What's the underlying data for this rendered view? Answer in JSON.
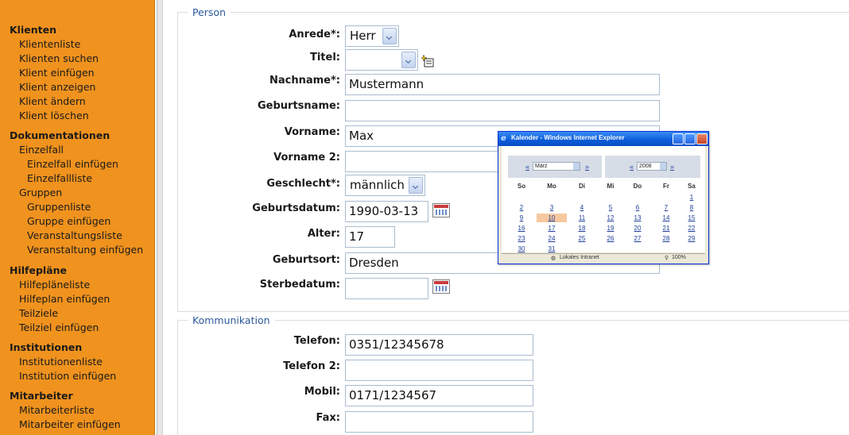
{
  "sidebar": {
    "groups": [
      {
        "label": "Klienten",
        "items": [
          "Klientenliste",
          "Klienten suchen",
          "Klient einfügen",
          "Klient anzeigen",
          "Klient ändern",
          "Klient löschen"
        ]
      },
      {
        "label": "Dokumentationen",
        "items": [
          "Einzelfall",
          "Gruppen"
        ],
        "sub_einzelfall": [
          "Einzelfall einfügen",
          "Einzelfallliste"
        ],
        "sub_gruppen": [
          "Gruppenliste",
          "Gruppe einfügen",
          "Veranstaltungsliste",
          "Veranstaltung einfügen"
        ]
      },
      {
        "label": "Hilfepläne",
        "items": [
          "Hilfepläneliste",
          "Hilfeplan einfügen",
          "Teilziele",
          "Teilziel einfügen"
        ]
      },
      {
        "label": "Institutionen",
        "items": [
          "Institutionenliste",
          "Institution einfügen"
        ]
      },
      {
        "label": "Mitarbeiter",
        "items": [
          "Mitarbeiterliste",
          "Mitarbeiter einfügen"
        ]
      }
    ]
  },
  "person": {
    "legend": "Person",
    "anrede": {
      "label": "Anrede*:",
      "value": "Herr"
    },
    "titel": {
      "label": "Titel:",
      "value": ""
    },
    "nachname": {
      "label": "Nachname*:",
      "value": "Mustermann"
    },
    "geburtsname": {
      "label": "Geburtsname:",
      "value": ""
    },
    "vorname": {
      "label": "Vorname:",
      "value": "Max"
    },
    "vorname2": {
      "label": "Vorname 2:",
      "value": ""
    },
    "geschlecht": {
      "label": "Geschlecht*:",
      "value": "männlich"
    },
    "geburtsdatum": {
      "label": "Geburtsdatum:",
      "value": "1990-03-13"
    },
    "alter": {
      "label": "Alter:",
      "value": "17"
    },
    "geburtsort": {
      "label": "Geburtsort:",
      "value": "Dresden"
    },
    "sterbedatum": {
      "label": "Sterbedatum:",
      "value": ""
    }
  },
  "kommunikation": {
    "legend": "Kommunikation",
    "telefon": {
      "label": "Telefon:",
      "value": "0351/12345678"
    },
    "telefon2": {
      "label": "Telefon 2:",
      "value": ""
    },
    "mobil": {
      "label": "Mobil:",
      "value": "0171/1234567"
    },
    "fax": {
      "label": "Fax:",
      "value": ""
    }
  },
  "popup": {
    "title": "Kalender - Windows Internet Explorer",
    "prev": "«",
    "next": "»",
    "month": "März",
    "year": "2008",
    "daynames": [
      "So",
      "Mo",
      "Di",
      "Mi",
      "Do",
      "Fr",
      "Sa"
    ],
    "weeks": [
      [
        "",
        "",
        "",
        "",
        "",
        "",
        "1"
      ],
      [
        "2",
        "3",
        "4",
        "5",
        "6",
        "7",
        "8"
      ],
      [
        "9",
        "10",
        "11",
        "12",
        "13",
        "14",
        "15"
      ],
      [
        "16",
        "17",
        "18",
        "19",
        "20",
        "21",
        "22"
      ],
      [
        "23",
        "24",
        "25",
        "26",
        "27",
        "28",
        "29"
      ],
      [
        "30",
        "31",
        "",
        "",
        "",
        "",
        ""
      ]
    ],
    "selected_day": "10",
    "status_zone": "Lokales Intranet",
    "zoom": "100%"
  }
}
